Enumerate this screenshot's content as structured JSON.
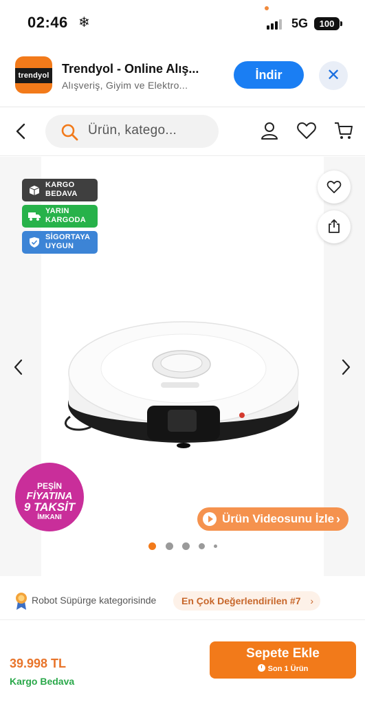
{
  "status_bar": {
    "time": "02:46",
    "weather_glyph": "❄",
    "network": "5G",
    "battery": "100"
  },
  "app_banner": {
    "logo_text": "trendyol",
    "name": "Trendyol - Online Alış...",
    "subtitle": "Alışveriş, Giyim ve Elektro...",
    "install_label": "İndir",
    "close_glyph": "✕",
    "brand_color": "#f27a1a",
    "install_color": "#1a7ef3"
  },
  "nav": {
    "search_placeholder": "Ürün, katego..."
  },
  "gallery": {
    "badges": [
      {
        "line1": "KARGO",
        "line2": "BEDAVA",
        "icon": "box-icon",
        "color": "#3f3f3f"
      },
      {
        "line1": "YARIN",
        "line2": "KARGODA",
        "icon": "truck-icon",
        "color": "#27b24a"
      },
      {
        "line1": "SİGORTAYA",
        "line2": "UYGUN",
        "icon": "shield-icon",
        "color": "#3c84d6"
      }
    ],
    "promo": {
      "line1": "PEŞİN",
      "line2": "FİYATINA",
      "line3": "9 TAKSİT",
      "line4": "İMKANI"
    },
    "video_label": "Ürün Videosunu İzle",
    "video_chevron": "›",
    "dots_total": 5,
    "dots_active_index": 0
  },
  "rank": {
    "text": "Robot Süpürge kategorisinde",
    "pill": "En Çok Değerlendirilen #7",
    "chevron": "›"
  },
  "bottom": {
    "price": "39.998 TL",
    "shipping": "Kargo Bedava",
    "cart_label": "Sepete Ekle",
    "cart_sub": "Son 1 Ürün"
  }
}
